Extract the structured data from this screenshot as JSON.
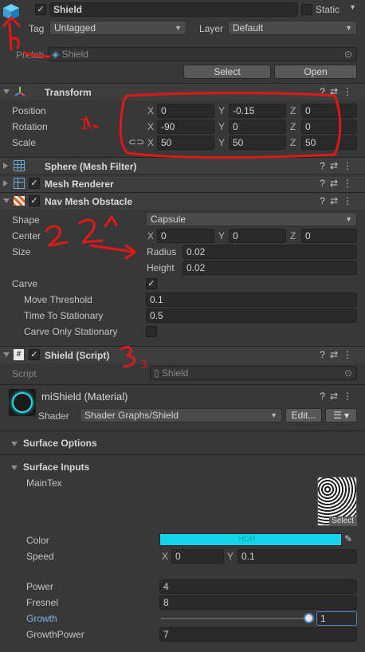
{
  "header": {
    "name": "Shield",
    "static_label": "Static",
    "tag_label": "Tag",
    "tag_value": "Untagged",
    "layer_label": "Layer",
    "layer_value": "Default",
    "prefab_label": "Prefab",
    "prefab_value": "Shield",
    "select_label": "Select",
    "open_label": "Open"
  },
  "transform": {
    "title": "Transform",
    "position_label": "Position",
    "rotation_label": "Rotation",
    "scale_label": "Scale",
    "pos": {
      "x": "0",
      "y": "-0.15",
      "z": "0"
    },
    "rot": {
      "x": "-90",
      "y": "0",
      "z": "0"
    },
    "scale": {
      "x": "50",
      "y": "50",
      "z": "50"
    }
  },
  "axes": {
    "x": "X",
    "y": "Y",
    "z": "Z"
  },
  "mesh_filter": {
    "title": "Sphere (Mesh Filter)"
  },
  "mesh_renderer": {
    "title": "Mesh Renderer"
  },
  "nav": {
    "title": "Nav Mesh Obstacle",
    "shape_label": "Shape",
    "shape_value": "Capsule",
    "center_label": "Center",
    "center": {
      "x": "0",
      "y": "0",
      "z": "0"
    },
    "size_label": "Size",
    "radius_label": "Radius",
    "radius_value": "0.02",
    "height_label": "Height",
    "height_value": "0.02",
    "carve_label": "Carve",
    "move_threshold_label": "Move Threshold",
    "move_threshold_value": "0.1",
    "time_label": "Time To Stationary",
    "time_value": "0.5",
    "carve_only_label": "Carve Only Stationary"
  },
  "script_comp": {
    "title": "Shield (Script)",
    "script_label": "Script",
    "script_value": "Shield"
  },
  "material": {
    "name": "miShield (Material)",
    "shader_label": "Shader",
    "shader_value": "Shader Graphs/Shield",
    "edit_label": "Edit..."
  },
  "surface_options": {
    "title": "Surface Options"
  },
  "surface_inputs": {
    "title": "Surface Inputs",
    "maintex_label": "MainTex",
    "select_label": "Select",
    "color_label": "Color",
    "color_hdr": "HDR",
    "color_hex": "#13d6ec",
    "speed_label": "Speed",
    "speed_x": "0",
    "speed_y": "0.1",
    "power_label": "Power",
    "power_value": "4",
    "fresnel_label": "Fresnel",
    "fresnel_value": "8",
    "growth_label": "Growth",
    "growth_value": "1",
    "growthpower_label": "GrowthPower",
    "growthpower_value": "7"
  },
  "annotations": {
    "one": "1.",
    "three": "3."
  }
}
